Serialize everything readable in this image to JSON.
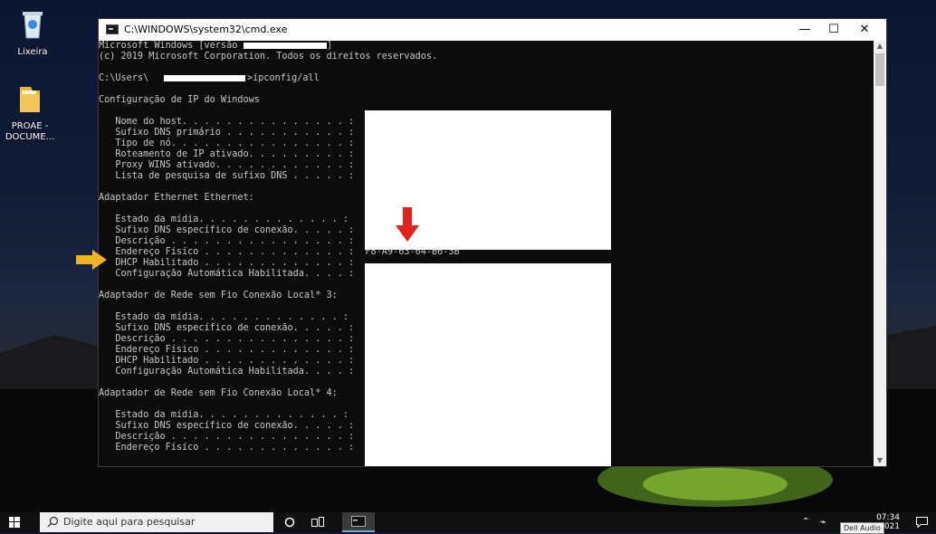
{
  "desktop": {
    "icons": [
      {
        "label": "Lixeira"
      },
      {
        "label": "PROAE - DOCUME..."
      }
    ]
  },
  "window": {
    "title": "C:\\WINDOWS\\system32\\cmd.exe",
    "controls": {
      "minimize": "—",
      "maximize": "☐",
      "close": "✕"
    }
  },
  "console": {
    "lines": [
      "Microsoft Windows [versão",
      "(c) 2019 Microsoft Corporation. Todos os direitos reservados.",
      "",
      "C:\\Users\\",
      "",
      "Configuração de IP do Windows",
      "",
      "   Nome do host. . . . . . . . . . . . . . . :",
      "   Sufixo DNS primário . . . . . . . . . . . :",
      "   Tipo de nó. . . . . . . . . . . . . . . . :",
      "   Roteamento de IP ativado. . . . . . . . . :",
      "   Proxy WINS ativado. . . . . . . . . . . . :",
      "   Lista de pesquisa de sufixo DNS . . . . . :",
      "",
      "Adaptador Ethernet Ethernet:",
      "",
      "   Estado da mídia. . . . . . . . . . . . . :",
      "   Sufixo DNS específico de conexão. . . . . :",
      "   Descrição . . . . . . . . . . . . . . . . :",
      "   Endereço Físico . . . . . . . . . . . . . :  F8-A9-63-64-B6-3B",
      "   DHCP Habilitado . . . . . . . . . . . . . :",
      "   Configuração Automática Habilitada. . . . :",
      "",
      "Adaptador de Rede sem Fio Conexão Local* 3:",
      "",
      "   Estado da mídia. . . . . . . . . . . . . :",
      "   Sufixo DNS específico de conexão. . . . . :",
      "   Descrição . . . . . . . . . . . . . . . . :",
      "   Endereço Físico . . . . . . . . . . . . . :",
      "   DHCP Habilitado . . . . . . . . . . . . . :",
      "   Configuração Automática Habilitada. . . . :",
      "",
      "Adaptador de Rede sem Fio Conexão Local* 4:",
      "",
      "   Estado da mídia. . . . . . . . . . . . . :",
      "   Sufixo DNS específico de conexão. . . . . :",
      "   Descrição . . . . . . . . . . . . . . . . :",
      "   Endereço Físico . . . . . . . . . . . . . :"
    ],
    "command": ">ipconfig/all",
    "version_suffix": "]"
  },
  "annotations": {
    "arrow_down_color": "#e0231c",
    "arrow_right_color": "#f0b323"
  },
  "taskbar": {
    "search_placeholder": "Digite aqui para pesquisar",
    "time": "07:34",
    "date": "/2021",
    "tooltip": "Dell Audio"
  }
}
